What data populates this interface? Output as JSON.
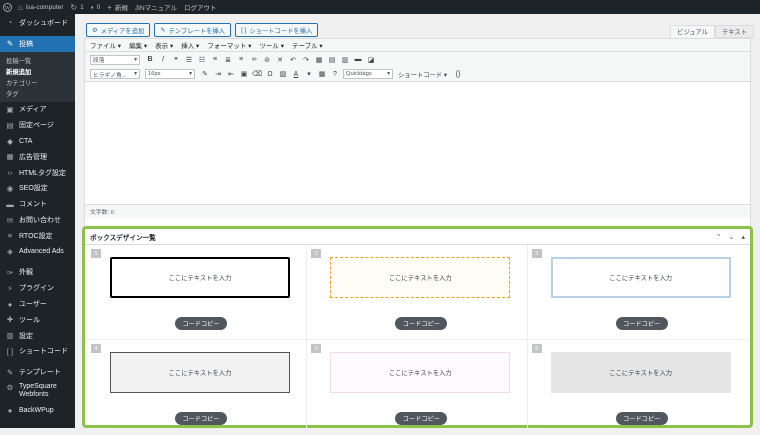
{
  "adminbar": {
    "site_name": "isa-computer",
    "updates_count": "1",
    "comments_count": "0",
    "new_label": "新規",
    "manual_label": "JINマニュアル",
    "logout_label": "ログアウト"
  },
  "sidebar": {
    "items": [
      {
        "icon": "dashboard-icon",
        "glyph": "◔",
        "label": "ダッシュボード"
      },
      {
        "icon": "pin-icon",
        "glyph": "✎",
        "label": "投稿"
      }
    ],
    "submenu": [
      "投稿一覧",
      "新規追加",
      "カテゴリー",
      "タグ"
    ],
    "items2": [
      {
        "icon": "media-icon",
        "glyph": "▣",
        "label": "メディア"
      },
      {
        "icon": "page-icon",
        "glyph": "▤",
        "label": "固定ページ"
      },
      {
        "icon": "tag-icon",
        "glyph": "◆",
        "label": "CTA"
      },
      {
        "icon": "ad-icon",
        "glyph": "▦",
        "label": "広告管理"
      },
      {
        "icon": "code-icon",
        "glyph": "‹›",
        "label": "HTMLタグ設定"
      },
      {
        "icon": "seo-icon",
        "glyph": "◉",
        "label": "SEO設定"
      },
      {
        "icon": "comment-icon",
        "glyph": "▬",
        "label": "コメント"
      },
      {
        "icon": "mail-icon",
        "glyph": "✉",
        "label": "お問い合わせ"
      },
      {
        "icon": "list-icon",
        "glyph": "≡",
        "label": "RTOC設定"
      },
      {
        "icon": "ads-icon",
        "glyph": "◈",
        "label": "Advanced Ads"
      }
    ],
    "items3": [
      {
        "icon": "appearance-icon",
        "glyph": "✑",
        "label": "外観"
      },
      {
        "icon": "plugin-icon",
        "glyph": "⚡",
        "label": "プラグイン"
      },
      {
        "icon": "user-icon",
        "glyph": "●",
        "label": "ユーザー"
      },
      {
        "icon": "tool-icon",
        "glyph": "✚",
        "label": "ツール"
      },
      {
        "icon": "settings-icon",
        "glyph": "▥",
        "label": "設定"
      },
      {
        "icon": "shortcode-icon",
        "glyph": "[ ]",
        "label": "ショートコード"
      }
    ],
    "items4": [
      {
        "icon": "template-icon",
        "glyph": "✎",
        "label": "テンプレート"
      },
      {
        "icon": "typesquare-icon",
        "glyph": "⚙",
        "label1": "TypeSquare",
        "label2": "Webfonts"
      },
      {
        "icon": "backup-icon",
        "glyph": "●",
        "label": "BackWPup"
      }
    ]
  },
  "editor": {
    "add_media": "メディアを追加",
    "insert_template": "テンプレートを挿入",
    "insert_shortcode": "ショートコードを挿入",
    "tab_visual": "ビジュアル",
    "tab_text": "テキスト",
    "menus": [
      "ファイル ▾",
      "編集 ▾",
      "表示 ▾",
      "挿入 ▾",
      "フォーマット ▾",
      "ツール ▾",
      "テーブル ▾"
    ],
    "format_select": "段落",
    "font_select": "ヒラギノ角...",
    "size_select": "16px",
    "quicktags_select": "Quicktags",
    "shortcode_label": "ショートコード",
    "word_count": "文字数: 0"
  },
  "box_panel": {
    "title": "ボックスデザイン一覧",
    "sample_text": "ここにテキストを入力",
    "copy_label": "コードコピー",
    "numbers": [
      "1",
      "2",
      "3",
      "4",
      "5",
      "6"
    ]
  }
}
